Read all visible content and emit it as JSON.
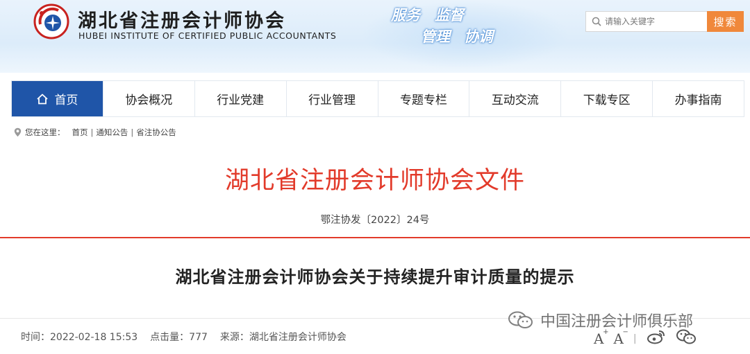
{
  "header": {
    "site_name_cn": "湖北省注册会计师协会",
    "site_name_en": "HUBEI INSTITUTE OF CERTIFIED PUBLIC ACCOUNTANTS",
    "slogans": [
      "服务",
      "监督",
      "管理",
      "协调"
    ],
    "search": {
      "placeholder": "请输入关键字",
      "button_label": "搜索"
    }
  },
  "nav": {
    "items": [
      {
        "label": "首页",
        "active": true,
        "icon": "home-icon"
      },
      {
        "label": "协会概况"
      },
      {
        "label": "行业党建"
      },
      {
        "label": "行业管理"
      },
      {
        "label": "专题专栏"
      },
      {
        "label": "互动交流"
      },
      {
        "label": "下载专区"
      },
      {
        "label": "办事指南"
      }
    ]
  },
  "breadcrumb": {
    "prefix": "您在这里：",
    "items": [
      "首页",
      "通知公告",
      "省注协公告"
    ]
  },
  "document": {
    "header": "湖北省注册会计师协会文件",
    "number": "鄂注协发〔2022〕24号",
    "title": "湖北省注册会计师协会关于持续提升审计质量的提示"
  },
  "meta": {
    "time": "时间：2022-02-18 15:53",
    "views": "点击量：777",
    "source": "来源：湖北省注册会计师协会"
  },
  "watermark": {
    "text": "中国注册会计师俱乐部",
    "icon": "wechat-icon"
  },
  "tools": {
    "font_increase": "A",
    "font_decrease": "A",
    "share_icons": [
      "weibo-icon",
      "wechat-icon"
    ]
  },
  "colors": {
    "nav_active": "#1f55a8",
    "search_button": "#f0883b",
    "document_red": "#e23a2a"
  }
}
